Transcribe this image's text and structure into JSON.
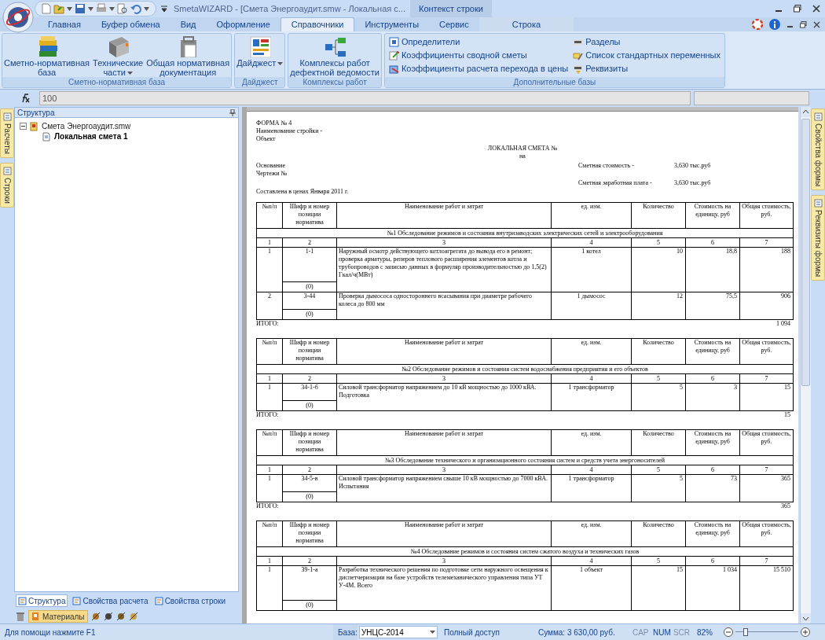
{
  "window": {
    "title": "SmetaWIZARD - [Смета Энергоаудит.smw - Локальная с...",
    "context_group": "Контекст строки"
  },
  "tabs": [
    {
      "label": "Главная",
      "selected": false,
      "context": false
    },
    {
      "label": "Буфер обмена",
      "selected": false,
      "context": false
    },
    {
      "label": "Вид",
      "selected": false,
      "context": false
    },
    {
      "label": "Оформление",
      "selected": false,
      "context": false
    },
    {
      "label": "Справочники",
      "selected": true,
      "context": false
    },
    {
      "label": "Инструменты",
      "selected": false,
      "context": false
    },
    {
      "label": "Сервис",
      "selected": false,
      "context": false
    },
    {
      "label": "Строка",
      "selected": false,
      "context": true
    }
  ],
  "ribbon_groups": [
    {
      "label": "Сметно-нормативная база",
      "kind": "large",
      "buttons": [
        {
          "label": "Сметно-нормативная\nбаза",
          "dropdown": false
        },
        {
          "label": "Технические\nчасти",
          "dropdown": true
        },
        {
          "label": "Общая нормативная\nдокументация",
          "dropdown": false
        }
      ]
    },
    {
      "label": "Дайджест",
      "kind": "large",
      "buttons": [
        {
          "label": "Дайджест",
          "dropdown": true
        }
      ]
    },
    {
      "label": "Комплексы работ",
      "kind": "large",
      "buttons": [
        {
          "label": "Комплексы работ\nдефектной ведомости",
          "dropdown": false
        }
      ]
    },
    {
      "label": "Дополнительные базы",
      "kind": "small",
      "buttons": [
        {
          "label": "Определители"
        },
        {
          "label": "Коэффициенты сводной сметы"
        },
        {
          "label": "Коэффициенты расчета перехода в цены"
        },
        {
          "label": "Разделы"
        },
        {
          "label": "Список стандартных переменных"
        },
        {
          "label": "Реквизиты"
        }
      ]
    }
  ],
  "formula_bar": {
    "value": "100"
  },
  "left_side_tabs": [
    "Расчеты",
    "Строки"
  ],
  "right_side_tabs": [
    "Свойства формы",
    "Реквизиты формы"
  ],
  "structure_panel": {
    "title": "Структура",
    "tree": [
      {
        "label": "Смета Энергоаудит.smw",
        "expanded": true,
        "active": false,
        "children": [
          {
            "label": "Локальная смета 1",
            "active": true
          }
        ]
      }
    ],
    "tabs": [
      {
        "label": "Структура",
        "selected": true
      },
      {
        "label": "Свойства расчета",
        "selected": false
      },
      {
        "label": "Свойства строки",
        "selected": false
      }
    ],
    "toolbar_button": "Материалы"
  },
  "document": {
    "form_lines": [
      "ФОРМА № 4",
      "Наименование стройки -",
      "Объект"
    ],
    "title": "ЛОКАЛЬНАЯ СМЕТА №",
    "subtitle": "на",
    "left_lines": [
      "Основание",
      "Чертежи №"
    ],
    "cost_lines": [
      {
        "label": "Сметная стоимость -",
        "value": "3,630 тыс.руб"
      },
      {
        "label": "Сметная заработная плата -",
        "value": "3,630 тыс.руб"
      }
    ],
    "prices_line": "Составлена в ценах Января 2011 г.",
    "sections": [
      {
        "columns": [
          "№п/п",
          "Шифр и номер позиции норматива",
          "Наименование работ и затрат",
          "ед. изм.",
          "Количество",
          "Стоимость на единицу, руб",
          "Общая стоимость, руб."
        ],
        "title": "№1 Обследование режимов и состояния внутризаводских электрических сетей и электрооборудования",
        "column_numbers": [
          "1",
          "2",
          "3",
          "4",
          "5",
          "6",
          "7"
        ],
        "rows": [
          {
            "number": "1",
            "code": "1-1",
            "sub": "(0)",
            "name": "Наружный осмотр действующего котлоагрегата до вывода его в ремонт; проверка арматуры, реперов теплового расширения элементов котла и трубопроводов с записью данных в формуляр производительностью до 1,5(2) Гкал/ч(МВт)",
            "unit": "1 котел",
            "quantity": "10",
            "price": "18,8",
            "total": "188"
          },
          {
            "number": "2",
            "code": "3-44",
            "sub": "(0)",
            "name": "Проверка дымососа одностороннего всасывания при диаметре рабочего колеса до 800 мм",
            "unit": "1 дымосос",
            "quantity": "12",
            "price": "75,5",
            "total": "906"
          }
        ],
        "total_label": "ИТОГО:",
        "total": "1 094"
      },
      {
        "columns": [
          "№п/п",
          "Шифр и номер позиции норматива",
          "Наименование работ и затрат",
          "ед. изм.",
          "Количество",
          "Стоимость на единицу, руб",
          "Общая стоимость, руб."
        ],
        "title": "№2 Обследование режимов и состояния систем водоснабжения предприятия и его объектов",
        "column_numbers": [
          "1",
          "2",
          "3",
          "4",
          "5",
          "6",
          "7"
        ],
        "rows": [
          {
            "number": "1",
            "code": "34-1-б",
            "sub": "(0)",
            "name": "Силовой трансформатор напряжением до 10 кВ мощностью до 1000 кВА. Подготовка",
            "unit": "1 трансформатор",
            "quantity": "5",
            "price": "3",
            "total": "15"
          }
        ],
        "total_label": "ИТОГО:",
        "total": "15"
      },
      {
        "columns": [
          "№п/п",
          "Шифр и номер позиции норматива",
          "Наименование работ и затрат",
          "ед. изм.",
          "Количество",
          "Стоимость на единицу, руб",
          "Общая стоимость, руб."
        ],
        "title": "№3 Обследование технического и организационного состояния систем и средств учета энергоносителей",
        "column_numbers": [
          "1",
          "2",
          "3",
          "4",
          "5",
          "6",
          "7"
        ],
        "rows": [
          {
            "number": "1",
            "code": "34-5-в",
            "sub": "(0)",
            "name": "Силовой трансформатор напряжением свыше 10 кВ мощностью до 7000 кВА. Испытания",
            "unit": "1 трансформатор",
            "quantity": "5",
            "price": "73",
            "total": "365"
          }
        ],
        "total_label": "ИТОГО:",
        "total": "365"
      },
      {
        "columns": [
          "№п/п",
          "Шифр и номер позиции норматива",
          "Наименование работ и затрат",
          "ед. изм.",
          "Количество",
          "Стоимость на единицу, руб",
          "Общая стоимость, руб."
        ],
        "title": "№4 Обследование режимов и состояния систем сжатого воздуха и технических газов",
        "column_numbers": [
          "1",
          "2",
          "3",
          "4",
          "5",
          "6",
          "7"
        ],
        "rows": [
          {
            "number": "1",
            "code": "39-1-а",
            "sub": "(0)",
            "name": "Разработка технического решения по подготовке сети наружного освещения к диспетчеризации на базе устройств телемеханического управления типа УТ У-4М. Всего",
            "unit": "1 объект",
            "quantity": "15",
            "price": "1 034",
            "total": "15 510"
          }
        ]
      }
    ]
  },
  "status_bar": {
    "help": "Для помощи нажмите F1",
    "base_label": "База:",
    "base_value": "УНЦС-2014",
    "access": "Полный доступ",
    "sum": "Сумма: 3 630,00 руб.",
    "indicators": [
      {
        "label": "CAP",
        "on": false
      },
      {
        "label": "NUM",
        "on": true
      },
      {
        "label": "SCR",
        "on": false
      }
    ],
    "zoom": "82%",
    "zoom_slider": {
      "level": 0.14
    }
  }
}
